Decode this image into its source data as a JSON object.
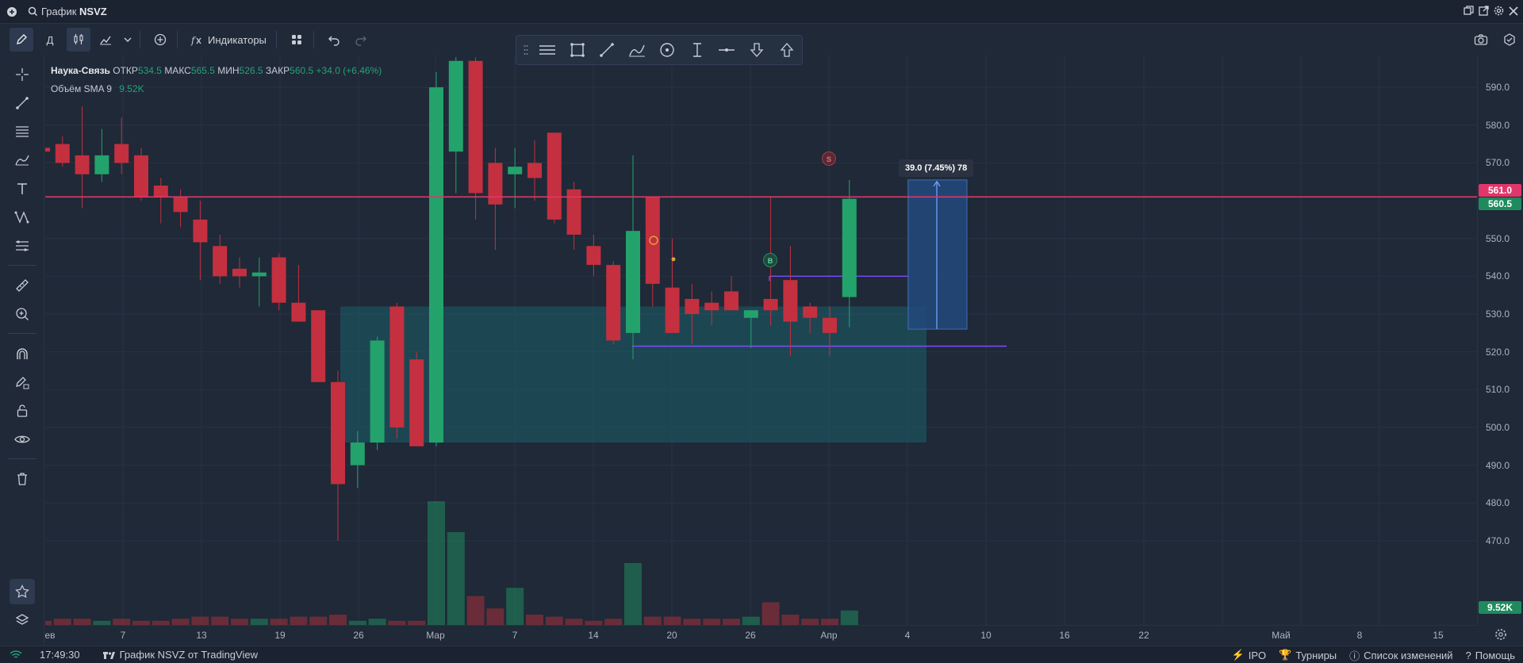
{
  "title": {
    "prefix": "График",
    "symbol": "NSVZ"
  },
  "toolbar": {
    "interval": "Д",
    "indicators_label": "Индикаторы"
  },
  "legend": {
    "name": "Наука-Связь",
    "open_label": "ОТКР",
    "open": "534.5",
    "high_label": "МАКС",
    "high": "565.5",
    "low_label": "МИН",
    "low": "526.5",
    "close_label": "ЗАКР",
    "close": "560.5",
    "change": "+34.0 (+6.46%)",
    "volume_label": "Объём SMA 9",
    "volume": "9.52K"
  },
  "price_axis": {
    "labels": [
      "590.0",
      "580.0",
      "570.0",
      "550.0",
      "540.0",
      "530.0",
      "520.0",
      "510.0",
      "500.0",
      "490.0",
      "480.0",
      "470.0"
    ],
    "tag_line": "561.0",
    "tag_last": "560.5",
    "tag_volume": "9.52K"
  },
  "time_axis": {
    "labels": [
      "ев",
      "7",
      "13",
      "19",
      "26",
      "Мар",
      "7",
      "14",
      "20",
      "26",
      "Апр",
      "4",
      "10",
      "16",
      "22",
      "Май",
      "8",
      "15"
    ]
  },
  "position_tool": {
    "label": "39.0 (7.45%) 78"
  },
  "markers": {
    "sell": "S",
    "buy": "B"
  },
  "statusbar": {
    "time": "17:49:30",
    "brand": "График NSVZ от TradingView",
    "ipo": "IPO",
    "tournaments": "Турниры",
    "changelog": "Список изменений",
    "help": "Помощь"
  },
  "colors": {
    "up": "#1f8a5e",
    "down": "#a82f3c",
    "line": "#e0366a",
    "zone": "#1b5f6b",
    "bg": "#1f2937"
  },
  "chart_data": {
    "type": "candlestick",
    "symbol": "NSVZ",
    "interval": "1D",
    "ylim": [
      462,
      598
    ],
    "candles": [
      {
        "o": 574,
        "h": 576,
        "l": 572,
        "c": 573
      },
      {
        "o": 575,
        "h": 577,
        "l": 569,
        "c": 570
      },
      {
        "o": 572,
        "h": 585,
        "l": 558,
        "c": 567
      },
      {
        "o": 567,
        "h": 579,
        "l": 565,
        "c": 572
      },
      {
        "o": 575,
        "h": 582,
        "l": 567,
        "c": 570
      },
      {
        "o": 572,
        "h": 574,
        "l": 560,
        "c": 561
      },
      {
        "o": 564,
        "h": 566,
        "l": 554,
        "c": 561
      },
      {
        "o": 561,
        "h": 563,
        "l": 553,
        "c": 557
      },
      {
        "o": 555,
        "h": 560,
        "l": 539,
        "c": 549
      },
      {
        "o": 548,
        "h": 551,
        "l": 538,
        "c": 540
      },
      {
        "o": 542,
        "h": 545,
        "l": 537,
        "c": 540
      },
      {
        "o": 540,
        "h": 545,
        "l": 532,
        "c": 541
      },
      {
        "o": 545,
        "h": 546,
        "l": 531,
        "c": 533
      },
      {
        "o": 533,
        "h": 543,
        "l": 528,
        "c": 528
      },
      {
        "o": 531,
        "h": 531,
        "l": 517,
        "c": 512
      },
      {
        "o": 512,
        "h": 515,
        "l": 470,
        "c": 485
      },
      {
        "o": 490,
        "h": 499,
        "l": 484,
        "c": 496
      },
      {
        "o": 496,
        "h": 524,
        "l": 494,
        "c": 523
      },
      {
        "o": 532,
        "h": 533,
        "l": 497,
        "c": 500
      },
      {
        "o": 518,
        "h": 520,
        "l": 496,
        "c": 495
      },
      {
        "o": 496,
        "h": 594,
        "l": 495,
        "c": 590
      },
      {
        "o": 573,
        "h": 598,
        "l": 562,
        "c": 597
      },
      {
        "o": 597,
        "h": 598,
        "l": 555,
        "c": 562
      },
      {
        "o": 570,
        "h": 574,
        "l": 547,
        "c": 559
      },
      {
        "o": 567,
        "h": 574,
        "l": 558,
        "c": 569
      },
      {
        "o": 570,
        "h": 576,
        "l": 560,
        "c": 566
      },
      {
        "o": 578,
        "h": 578,
        "l": 554,
        "c": 555
      },
      {
        "o": 563,
        "h": 565,
        "l": 547,
        "c": 551
      },
      {
        "o": 548,
        "h": 551,
        "l": 540,
        "c": 543
      },
      {
        "o": 543,
        "h": 544,
        "l": 522,
        "c": 523
      },
      {
        "o": 525,
        "h": 572,
        "l": 518,
        "c": 552
      },
      {
        "o": 561,
        "h": 561,
        "l": 532,
        "c": 538
      },
      {
        "o": 537,
        "h": 550,
        "l": 529,
        "c": 525
      },
      {
        "o": 534,
        "h": 538,
        "l": 522,
        "c": 530
      },
      {
        "o": 533,
        "h": 536,
        "l": 527,
        "c": 531
      },
      {
        "o": 536,
        "h": 540,
        "l": 531,
        "c": 531
      },
      {
        "o": 529,
        "h": 530,
        "l": 521,
        "c": 531
      },
      {
        "o": 534,
        "h": 561,
        "l": 527,
        "c": 531
      },
      {
        "o": 539,
        "h": 548,
        "l": 519,
        "c": 528
      },
      {
        "o": 532,
        "h": 533,
        "l": 525,
        "c": 529
      },
      {
        "o": 529,
        "h": 532,
        "l": 519,
        "c": 525
      },
      {
        "o": 534.5,
        "h": 565.5,
        "l": 526.5,
        "c": 560.5
      }
    ],
    "volume": [
      2,
      3,
      3,
      2,
      3,
      2,
      2,
      3,
      4,
      4,
      3,
      3,
      3,
      4,
      4,
      5,
      2,
      3,
      2,
      2,
      60,
      45,
      14,
      8,
      18,
      5,
      4,
      3,
      2,
      3,
      30,
      4,
      4,
      3,
      3,
      3,
      4,
      11,
      5,
      3,
      3,
      7
    ],
    "horizontal_line": 561.0,
    "zone": {
      "from": 496,
      "to": 532
    },
    "long_position": {
      "entry": 526,
      "target": 565.5,
      "label": "39.0 (7.45%) 78"
    },
    "support_line": 521.5,
    "resistance_segment": 540
  }
}
